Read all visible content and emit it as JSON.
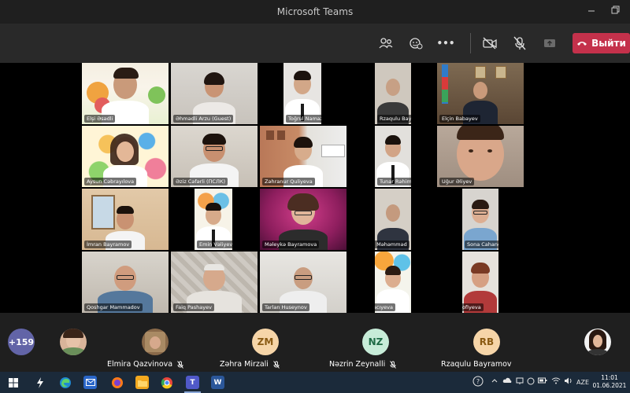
{
  "window": {
    "title": "Microsoft Teams",
    "minimize_icon": "minimize-icon",
    "restore_icon": "restore-icon"
  },
  "toolbar": {
    "participants_icon": "people-icon",
    "reactions_icon": "raise-hand-icon",
    "more_label": "•••",
    "camera_icon": "camera-off-icon",
    "mic_icon": "mic-off-icon",
    "share_icon": "share-tray-icon",
    "leave_label": "Выйти",
    "leave_color": "#c4314b"
  },
  "tiles": [
    {
      "name": "Elşi Əsədli"
    },
    {
      "name": "Əhmədli Arzu (Guest)"
    },
    {
      "name": "Toğrul Namazov"
    },
    {
      "name": "Rzaqulu Bayramov"
    },
    {
      "name": "Elçin Babayev"
    },
    {
      "name": "Aysun Cəbrayılova"
    },
    {
      "name": "Əziz Cəfərli (ПСЛК)"
    },
    {
      "name": "Zəhranur Quliyeva"
    },
    {
      "name": "Tunar Rəhimov"
    },
    {
      "name": "Uğur Əliyev"
    },
    {
      "name": "İmran Bayramov"
    },
    {
      "name": "Emin Vəliyev"
    },
    {
      "name": "Məleykə Bayramova"
    },
    {
      "name": "Məhərrəmov Məhəmməd"
    },
    {
      "name": "Sona Cahangirova"
    },
    {
      "name": "Qoshgar Mammadov"
    },
    {
      "name": "Faiq Pashayev"
    },
    {
      "name": "Tarlan Huseynov"
    },
    {
      "name": "Ayan Hacıyeva"
    },
    {
      "name": "Aynur Sofiyeva"
    }
  ],
  "strip": {
    "overflow_count": "+159",
    "participants": [
      {
        "name": "Elmira Qazvinova",
        "initials": ""
      },
      {
        "name": "Zəhra Mirzali",
        "initials": "ZM",
        "color": "#f6d5a8",
        "text_color": "#8a5a12"
      },
      {
        "name": "Nəzrin Zeynalli",
        "initials": "NZ",
        "color": "#c7ecd8",
        "text_color": "#1d6b45"
      },
      {
        "name": "Rzaqulu Bayramov",
        "initials": "RB",
        "color": "#f6d5a8",
        "text_color": "#8a5a12"
      }
    ]
  },
  "taskbar": {
    "language": "AZE",
    "time": "11:01",
    "date": "01.06.2021"
  }
}
